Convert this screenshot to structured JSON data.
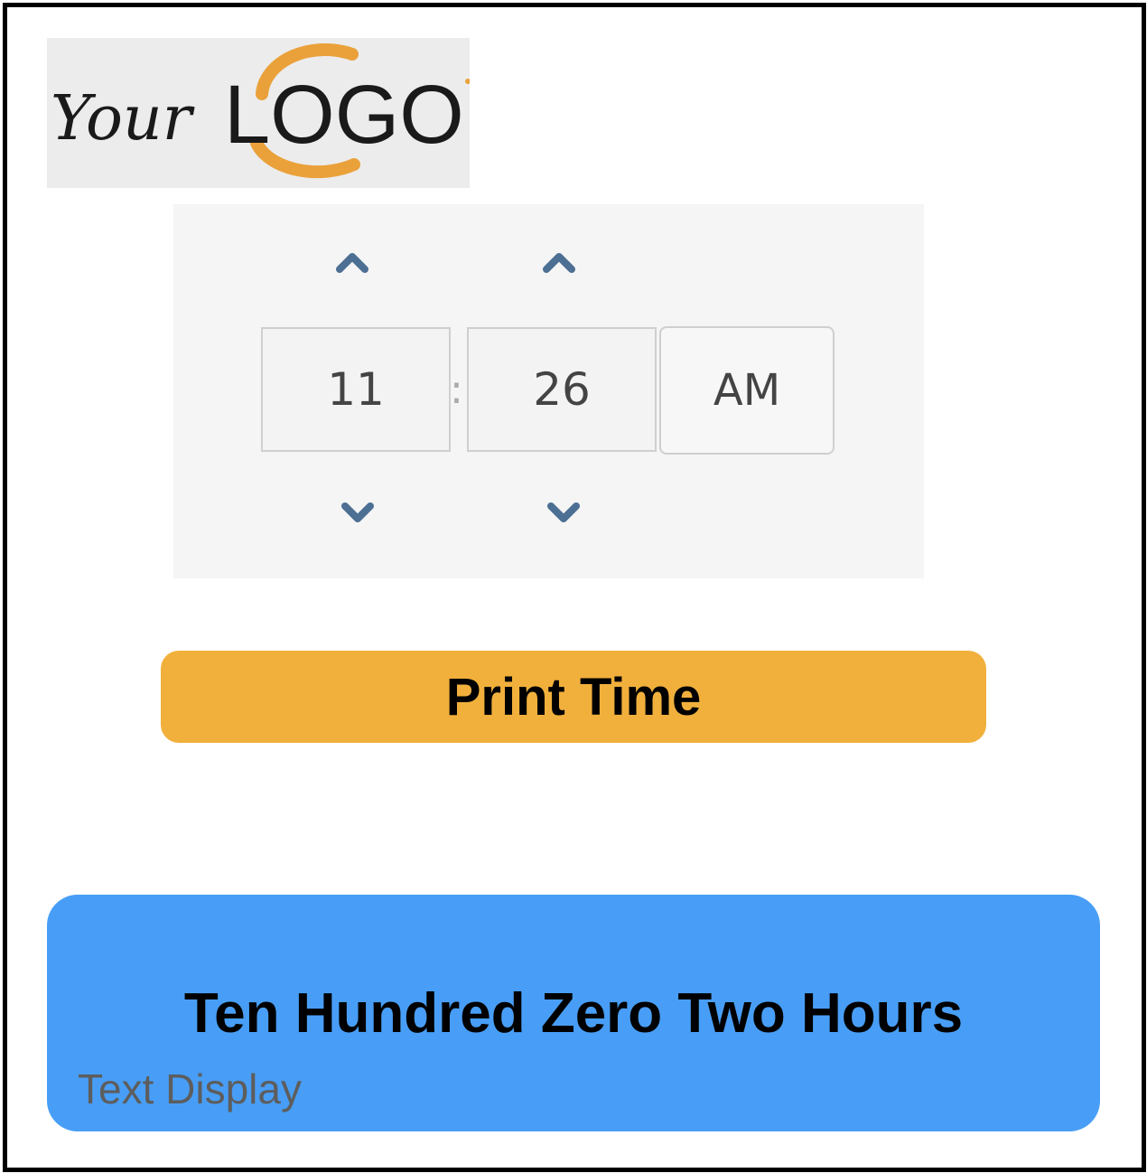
{
  "logo": {
    "text_your": "Your",
    "text_logo": "LOGO"
  },
  "picker": {
    "hour": "11",
    "separator": ":",
    "minute": "26",
    "period": "AM"
  },
  "print_button": {
    "label": "Print Time"
  },
  "display": {
    "text": "Ten Hundred Zero Two Hours",
    "label": "Text Display"
  },
  "colors": {
    "button": "#f1b03c",
    "display": "#489ef6",
    "arrow": "#4c6f93",
    "logo_ring": "#eaa13a"
  },
  "icons": {
    "hour_up": "chevron-up-icon",
    "minute_up": "chevron-up-icon",
    "hour_down": "chevron-down-icon",
    "minute_down": "chevron-down-icon"
  }
}
